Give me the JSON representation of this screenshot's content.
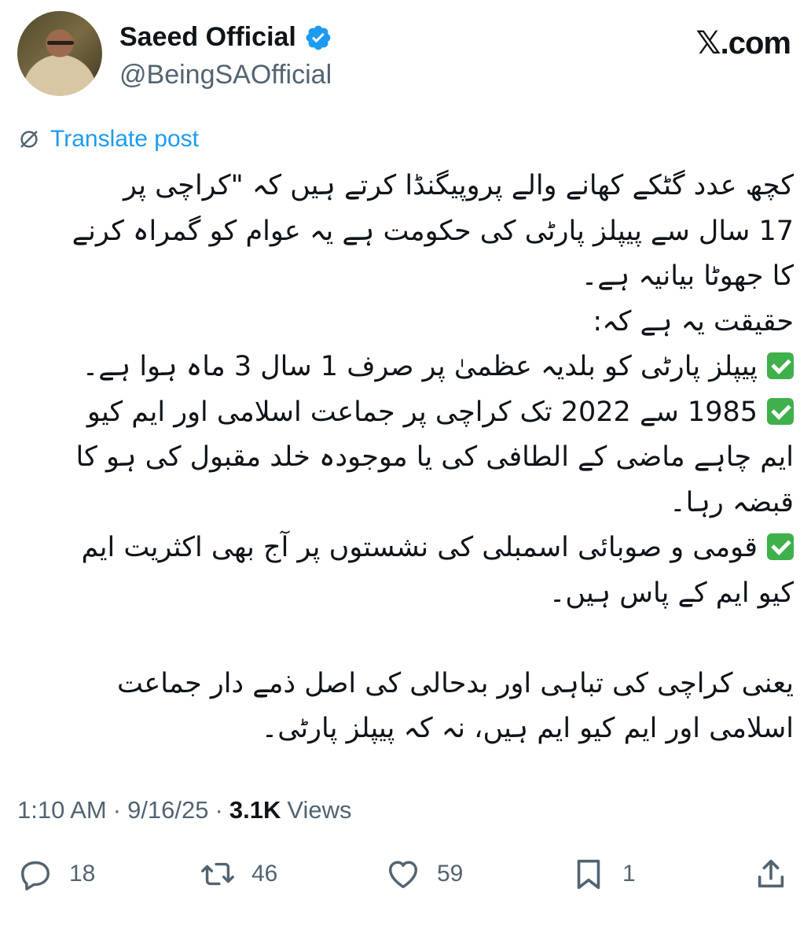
{
  "author": {
    "display_name": "Saeed Official",
    "handle": "@BeingSAOfficial",
    "verified": true,
    "badge_color": "#1d9bf0"
  },
  "brand": {
    "label": "𝕏.com"
  },
  "translate": {
    "label": "Translate post",
    "icon": "translate-icon",
    "color": "#1d9bf0"
  },
  "post": {
    "lines": [
      "کچھ عدد گٹکے کھانے والے پروپیگنڈا کرتے ہیں کہ \"کراچی پر",
      "17 سال سے پیپلز پارٹی کی حکومت ہے یہ عوام کو گمراہ کرنے",
      "کا جھوٹا بیانیہ ہے۔",
      "حقیقت یہ ہے کہ:",
      "پیپلز پارٹی کو بلدیہ عظمیٰ پر صرف 1 سال 3 ماہ ہوا ہے۔",
      "1985 سے 2022 تک کراچی پر جماعت اسلامی اور ایم کیو",
      "ایم چاہے ماضی کے الطافی کی یا موجودہ خلد مقبول کی ہو کا",
      "قبضہ رہا۔",
      "قومی و صوبائی اسمبلی کی نشستوں پر آج بھی اکثریت ایم",
      "کیو ایم کے پاس ہیں۔",
      "یعنی کراچی کی تباہی اور بدحالی کی اصل ذمے دار جماعت",
      "اسلامی اور ایم کیو ایم ہیں، نہ کہ پیپلز پارٹی۔"
    ],
    "checkmark_emoji": "✅",
    "checkmark_color": "#3fb04b"
  },
  "meta": {
    "time": "1:10 AM",
    "separator": "·",
    "date": "9/16/25",
    "views_count": "3.1K",
    "views_label": "Views"
  },
  "actions": {
    "replies": "18",
    "reposts": "46",
    "likes": "59",
    "bookmarks": "1"
  }
}
